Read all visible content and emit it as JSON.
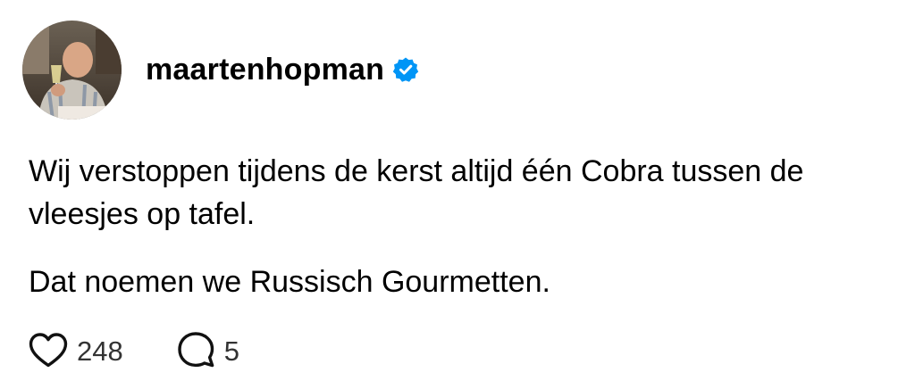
{
  "post": {
    "author": {
      "username": "maartenhopman",
      "verified": true,
      "avatar_icon": "profile-photo-avatar"
    },
    "paragraphs": [
      "Wij verstoppen tijdens de kerst altijd één Cobra tussen de vleesjes op tafel.",
      "Dat noemen we Russisch Gourmetten."
    ],
    "actions": {
      "likes": {
        "icon": "heart-icon",
        "count": "248"
      },
      "replies": {
        "icon": "comment-icon",
        "count": "5"
      }
    }
  },
  "colors": {
    "verified_badge": "#0095F6",
    "text": "#000000",
    "counts": "#333333"
  }
}
